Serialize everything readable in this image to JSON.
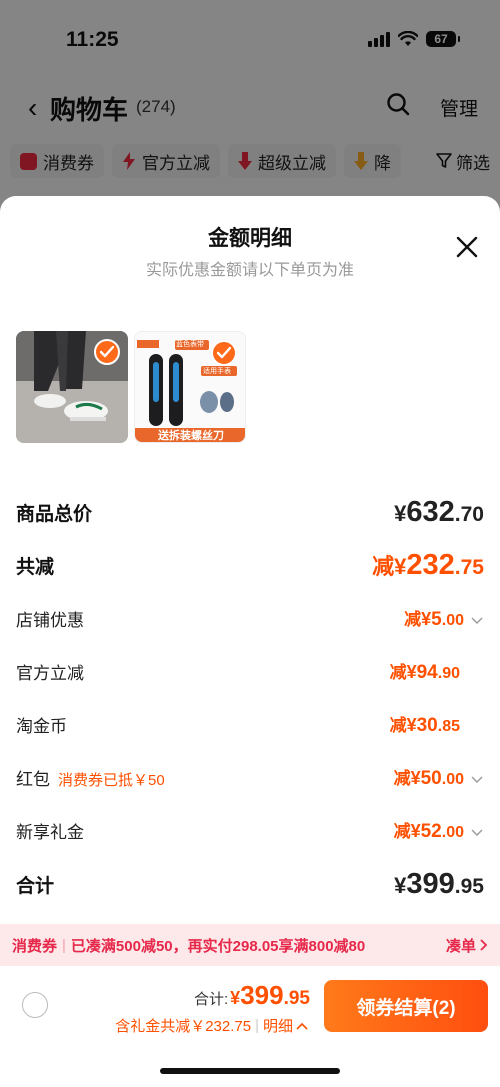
{
  "status_bar": {
    "time": "11:25",
    "battery": "67"
  },
  "cart_header": {
    "back_glyph": "‹",
    "title": "购物车",
    "count": "(274)",
    "manage_label": "管理"
  },
  "filters": [
    {
      "label": "消费券",
      "icon": "coupon-icon",
      "color": "#e8283c"
    },
    {
      "label": "官方立减",
      "icon": "lightning-icon",
      "color": "#e8283c"
    },
    {
      "label": "超级立减",
      "icon": "arrow-down-icon",
      "color": "#e8283c"
    },
    {
      "label": "降",
      "icon": "arrow-down-icon",
      "color": "#f5a623"
    }
  ],
  "filter_button": {
    "label": "筛选",
    "icon": "filter-icon"
  },
  "sheet": {
    "title": "金额明细",
    "subtitle": "实际优惠金额请以下单页为准",
    "close_icon": "close-icon"
  },
  "products": [
    {
      "name": "sneaker-photo",
      "checked": true
    },
    {
      "name": "watch-band-photo",
      "checked": true,
      "top_tag": "蓝色表带",
      "corner_tag": "适用手表",
      "banner": "送拆装螺丝刀"
    }
  ],
  "summary": {
    "goods_total": {
      "label": "商品总价",
      "yen": "¥",
      "int": "632",
      "dec": ".70"
    },
    "total_reduce": {
      "label": "共减",
      "prefix": "减",
      "yen": "¥",
      "int": "232",
      "dec": ".75"
    },
    "items": [
      {
        "label": "店铺优惠",
        "prefix": "减",
        "yen": "¥",
        "int": "5",
        "dec": ".00",
        "has_chevron": true,
        "tag": ""
      },
      {
        "label": "官方立减",
        "prefix": "减",
        "yen": "¥",
        "int": "94",
        "dec": ".90",
        "has_chevron": false,
        "tag": ""
      },
      {
        "label": "淘金币",
        "prefix": "减",
        "yen": "¥",
        "int": "30",
        "dec": ".85",
        "has_chevron": false,
        "tag": ""
      },
      {
        "label": "红包",
        "prefix": "减",
        "yen": "¥",
        "int": "50",
        "dec": ".00",
        "has_chevron": true,
        "tag": "消费券已抵￥50"
      },
      {
        "label": "新享礼金",
        "prefix": "减",
        "yen": "¥",
        "int": "52",
        "dec": ".00",
        "has_chevron": true,
        "tag": ""
      }
    ],
    "grand_total": {
      "label": "合计",
      "yen": "¥",
      "int": "399",
      "dec": ".95"
    }
  },
  "promo_bar": {
    "tag": "消费券",
    "text": "已凑满500减50，再实付298.05享满800减80",
    "link": "凑单",
    "color": "#e6284a"
  },
  "bottom_bar": {
    "total_label": "合计:",
    "yen": "¥",
    "int": "399",
    "dec": ".95",
    "saved_text": "含礼金共减￥232.75",
    "detail_link": "明细",
    "checkout_label": "领券结算(2)",
    "accent": "#ff5000"
  }
}
